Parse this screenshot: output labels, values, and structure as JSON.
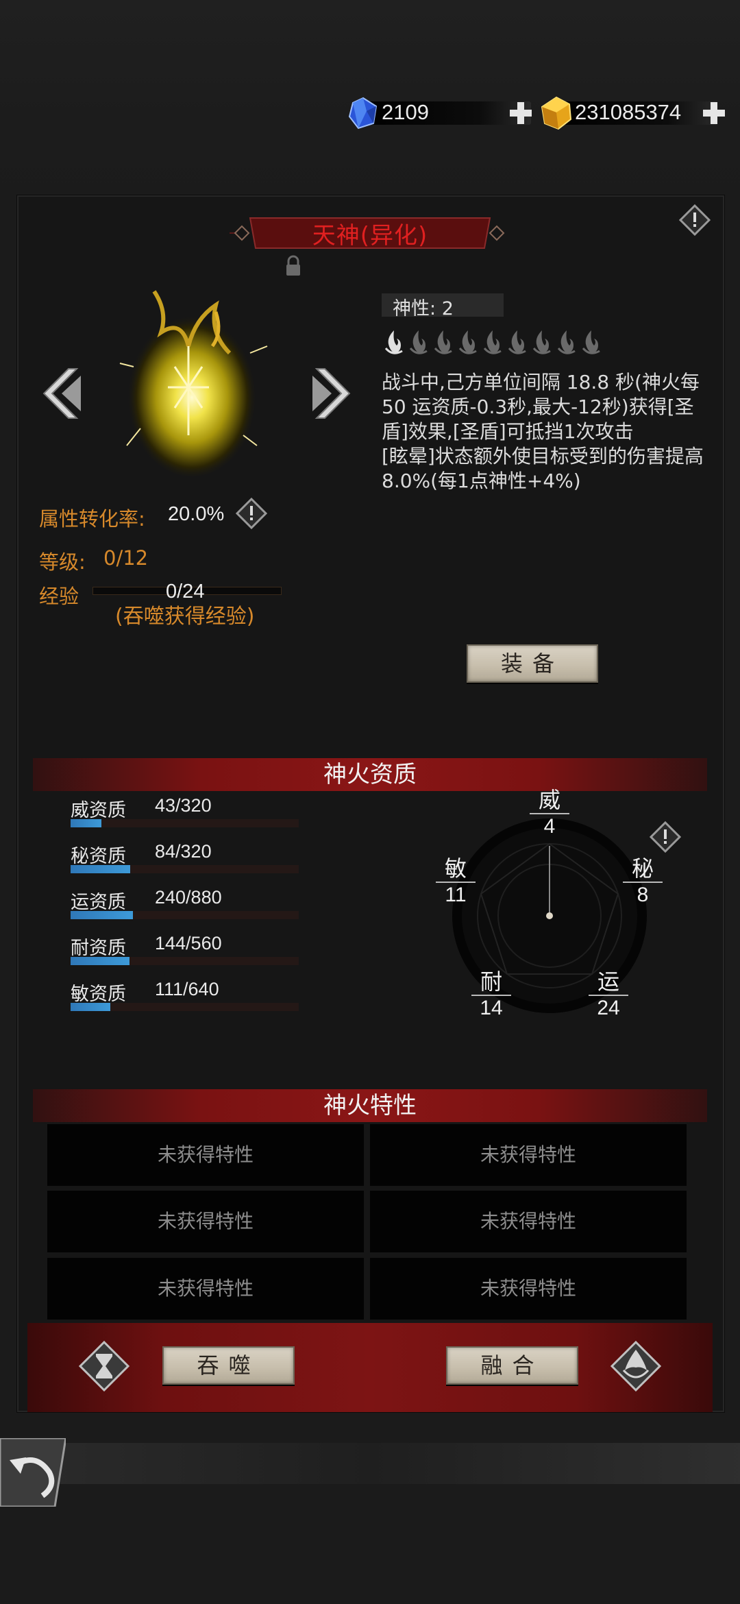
{
  "currency": {
    "gems": "2109",
    "gold": "231085374",
    "gem_icon": "blue-crystal-icon",
    "gold_icon": "gold-crystal-icon",
    "add_icon": "plus-icon"
  },
  "header": {
    "title": "天神(异化)"
  },
  "stats": {
    "conversion_label": "属性转化率:",
    "conversion_value": "20.0%",
    "level_label": "等级:",
    "level_value": "0/12",
    "exp_label": "经验",
    "exp_value": "0/24",
    "exp_progress": 0,
    "exp_hint": "(吞噬获得经验)"
  },
  "divinity": {
    "label": "神性:",
    "value": "2",
    "icon_count": 9,
    "highlighted": 1
  },
  "description": [
    "战斗中,己方单位间隔 18.8 秒(神火每 50 运资质-0.3秒,最大-12秒)获得[圣盾]效果,[圣盾]可抵挡1次攻击",
    "[眩晕]状态额外使目标受到的伤害提高 8.0%(每1点神性+4%)"
  ],
  "buttons": {
    "equip": "装备",
    "devour": "吞噬",
    "fuse": "融合"
  },
  "aptitude": {
    "title": "神火资质",
    "items": [
      {
        "name": "威资质",
        "value": "43/320",
        "ratio": 0.134
      },
      {
        "name": "秘资质",
        "value": "84/320",
        "ratio": 0.2625
      },
      {
        "name": "运资质",
        "value": "240/880",
        "ratio": 0.273
      },
      {
        "name": "耐资质",
        "value": "144/560",
        "ratio": 0.257
      },
      {
        "name": "敏资质",
        "value": "111/640",
        "ratio": 0.173
      }
    ],
    "pentagon": [
      {
        "name": "威",
        "value": "4"
      },
      {
        "name": "秘",
        "value": "8"
      },
      {
        "name": "运",
        "value": "24"
      },
      {
        "name": "耐",
        "value": "14"
      },
      {
        "name": "敏",
        "value": "11"
      }
    ]
  },
  "traits": {
    "title": "神火特性",
    "cells": [
      "未获得特性",
      "未获得特性",
      "未获得特性",
      "未获得特性",
      "未获得特性",
      "未获得特性"
    ]
  },
  "colors": {
    "title_red": "#e02020",
    "label_orange": "#d7892b",
    "band_red": "#8a1616",
    "bar_blue": "#3d9ad8"
  }
}
